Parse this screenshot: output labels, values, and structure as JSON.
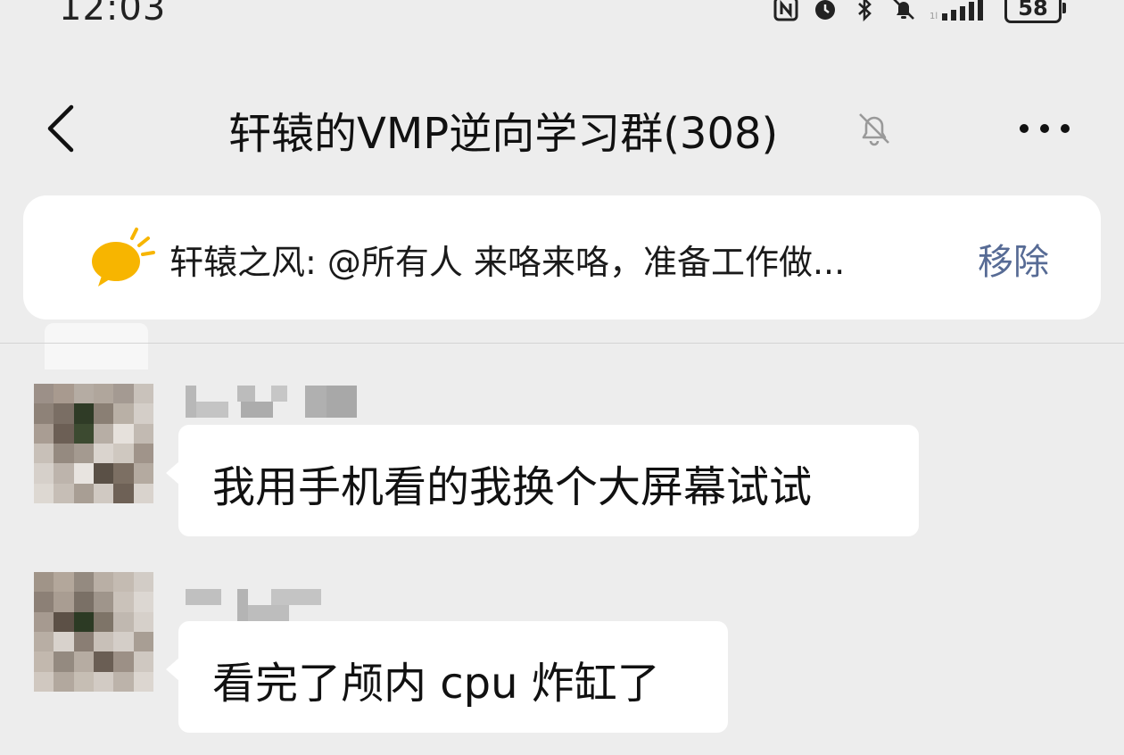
{
  "status_bar": {
    "time": "12:03",
    "battery": "58",
    "icons": [
      "nfc-icon",
      "alarm-icon",
      "bluetooth-icon",
      "bell-off-icon",
      "signal-icon",
      "battery-icon"
    ]
  },
  "header": {
    "title": "轩辕的VMP逆向学习群(308)",
    "back_icon": "back-chevron-icon",
    "mute_icon": "bell-off-icon",
    "more_icon": "more-dots-icon"
  },
  "pinned": {
    "icon": "announcement-icon",
    "text": "轩辕之风: @所有人 来咯来咯，准备工作做...",
    "remove_label": "移除",
    "accent_color": "#576b95",
    "icon_color": "#f7b500"
  },
  "messages": [
    {
      "avatar": "pixelated-avatar",
      "text": "我用手机看的我换个大屏幕试试"
    },
    {
      "avatar": "pixelated-avatar",
      "text": "看完了颅内 cpu 炸缸了"
    }
  ],
  "colors": {
    "background": "#ededed",
    "bubble": "#ffffff"
  }
}
